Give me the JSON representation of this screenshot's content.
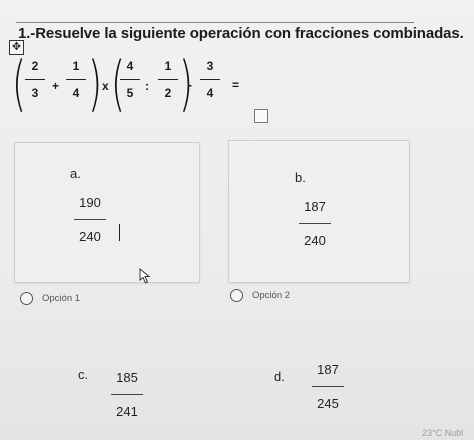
{
  "question": {
    "title": "1.-Resuelve la siguiente operación con fracciones combinadas.",
    "expression": {
      "frac1": {
        "num": "2",
        "den": "3"
      },
      "op1": "+",
      "frac2": {
        "num": "1",
        "den": "4"
      },
      "op2": "x",
      "frac3": {
        "num": "4",
        "den": "5"
      },
      "op3": ":",
      "frac4": {
        "num": "1",
        "den": "2"
      },
      "op4": "-",
      "frac5": {
        "num": "3",
        "den": "4"
      },
      "equals": "="
    }
  },
  "options": [
    {
      "letter": "a.",
      "num": "190",
      "den": "240",
      "label": "Opción 1"
    },
    {
      "letter": "b.",
      "num": "187",
      "den": "240",
      "label": "Opción 2"
    },
    {
      "letter": "c.",
      "num": "185",
      "den": "241"
    },
    {
      "letter": "d.",
      "num": "187",
      "den": "245"
    }
  ],
  "footer": {
    "corner_text": "23°C Nubl"
  }
}
